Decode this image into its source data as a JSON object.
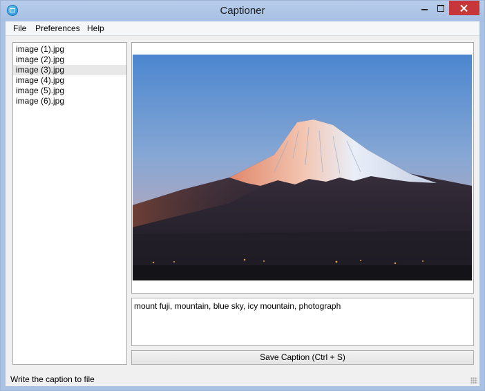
{
  "window": {
    "title": "Captioner"
  },
  "menu": [
    "File",
    "Preferences",
    "Help"
  ],
  "files": [
    "image (1).jpg",
    "image (2).jpg",
    "image (3).jpg",
    "image (4).jpg",
    "image (5).jpg",
    "image (6).jpg"
  ],
  "selected_file": "image (3).jpg",
  "image": {
    "icon": "mountain-photo"
  },
  "caption": {
    "text": "mount fuji, mountain, blue sky, icy mountain, photograph"
  },
  "buttons": {
    "save_label": "Save Caption (Ctrl + S)"
  },
  "status": {
    "text": "Write the caption to file"
  },
  "colors": {
    "close": "#c7373a",
    "title_bar": "#a9c2e4",
    "selection": "#e8e8e8"
  }
}
